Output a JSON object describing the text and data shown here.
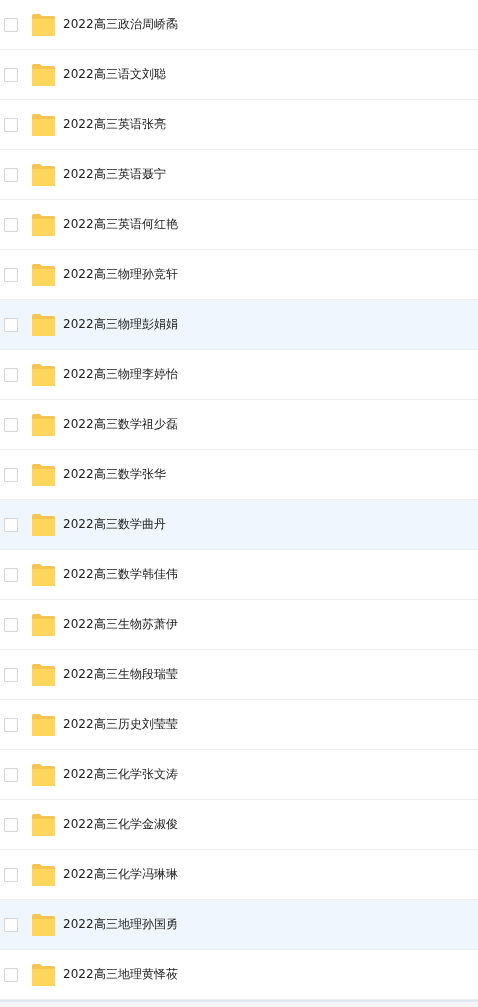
{
  "files": [
    {
      "name": "2022高三政治周峤矞",
      "checked": false,
      "highlighted": false
    },
    {
      "name": "2022高三语文刘聪",
      "checked": false,
      "highlighted": false
    },
    {
      "name": "2022高三英语张亮",
      "checked": false,
      "highlighted": false
    },
    {
      "name": "2022高三英语聂宁",
      "checked": false,
      "highlighted": false
    },
    {
      "name": "2022高三英语何红艳",
      "checked": false,
      "highlighted": false
    },
    {
      "name": "2022高三物理孙竞轩",
      "checked": false,
      "highlighted": false
    },
    {
      "name": "2022高三物理彭娟娟",
      "checked": false,
      "highlighted": true
    },
    {
      "name": "2022高三物理李婷怡",
      "checked": false,
      "highlighted": false
    },
    {
      "name": "2022高三数学祖少磊",
      "checked": false,
      "highlighted": false
    },
    {
      "name": "2022高三数学张华",
      "checked": false,
      "highlighted": false
    },
    {
      "name": "2022高三数学曲丹",
      "checked": false,
      "highlighted": true
    },
    {
      "name": "2022高三数学韩佳伟",
      "checked": false,
      "highlighted": false
    },
    {
      "name": "2022高三生物苏萧伊",
      "checked": false,
      "highlighted": false
    },
    {
      "name": "2022高三生物段瑞莹",
      "checked": false,
      "highlighted": false
    },
    {
      "name": "2022高三历史刘莹莹",
      "checked": false,
      "highlighted": false
    },
    {
      "name": "2022高三化学张文涛",
      "checked": false,
      "highlighted": false
    },
    {
      "name": "2022高三化学金淑俊",
      "checked": false,
      "highlighted": false
    },
    {
      "name": "2022高三化学冯琳琳",
      "checked": false,
      "highlighted": false
    },
    {
      "name": "2022高三地理孙国勇",
      "checked": false,
      "highlighted": true
    },
    {
      "name": "2022高三地理黄怿莜",
      "checked": false,
      "highlighted": false
    }
  ]
}
